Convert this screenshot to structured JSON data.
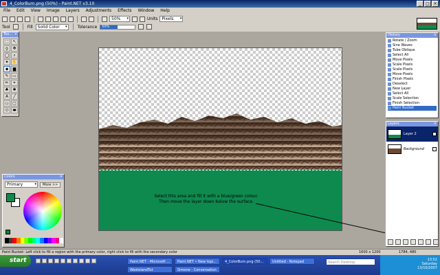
{
  "window": {
    "title": "4_ColorBurn.png (50%) - Paint.NET v3.10"
  },
  "menu": [
    "File",
    "Edit",
    "View",
    "Image",
    "Layers",
    "Adjustments",
    "Effects",
    "Window",
    "Help"
  ],
  "toolbar": {
    "zoom": "50%",
    "units_label": "Units",
    "units_value": "Pixels"
  },
  "toolbar2": {
    "tool_label": "Tool",
    "fill_label": "Fill",
    "fill_value": "Solid Color",
    "tolerance_label": "Tolerance",
    "tolerance_value": "50%",
    "tolerance_fraction": 0.5
  },
  "tools_panel": {
    "title": "Too..."
  },
  "canvas": {
    "annotation_line1": "Select this area and fill it with a blue/green colour.",
    "annotation_line2": "Then move the layer down below the surface.",
    "water_color": "#0e8a4f"
  },
  "colors_panel": {
    "title": "Colors",
    "mode": "Primary",
    "more_button": "More >>",
    "primary": "#0e8a4f",
    "secondary": "#ffffff"
  },
  "history_panel": {
    "title": "History",
    "items": [
      "Rotate / Zoom",
      "Sine Waves",
      "Tube Oblique",
      "Select All",
      "Move Pixels",
      "Scale Pixels",
      "Scale Pixels",
      "Move Pixels",
      "Finish Pixels",
      "Deselect",
      "New Layer",
      "Select All",
      "Scale Selection",
      "Finish Selection",
      "Paint Bucket"
    ],
    "selected_index": 14
  },
  "layers_panel": {
    "title": "Layers",
    "layers": [
      {
        "name": "Layer 2",
        "selected": true
      },
      {
        "name": "Background",
        "selected": false
      }
    ]
  },
  "statusbar": {
    "hint": "Paint Bucket: Left click to fill a region with the primary color, right click to fill with the secondary color",
    "size": "1600 x 1200",
    "cursor": "1784, 480"
  },
  "taskbar": {
    "start": "start",
    "buttons_row1": [
      "Paint.NET - Microsoft ...",
      "Paint.NET • New topi...",
      "4_ColorBurn.png (50...",
      "Untitled - Notepad"
    ],
    "buttons_row2": [
      "WastelandTut",
      "Simone - Conversation"
    ],
    "search_placeholder": "Search Desktop",
    "time": "13:52",
    "day": "Saturday",
    "date": "13/10/2007"
  }
}
